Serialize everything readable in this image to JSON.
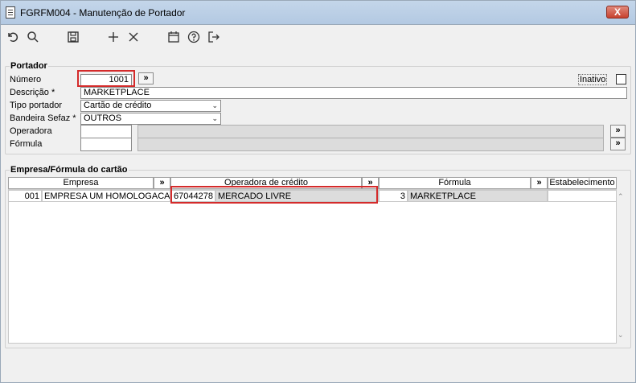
{
  "window": {
    "title": "FGRFM004 - Manutenção de Portador",
    "close_label": "X"
  },
  "toolbar": {
    "icons": [
      "undo-icon",
      "search-icon",
      "save-icon",
      "add-icon",
      "delete-icon",
      "calendar-icon",
      "help-icon",
      "exit-icon"
    ]
  },
  "portador": {
    "group_title": "Portador",
    "numero_label": "Número",
    "numero_value": "1001",
    "more_label": "»",
    "inativo_label": "Inativo",
    "inativo_checked": false,
    "descricao_label": "Descrição *",
    "descricao_value": "MARKETPLACE",
    "tipo_label": "Tipo portador",
    "tipo_value": "Cartão de crédito",
    "bandeira_label": "Bandeira Sefaz *",
    "bandeira_value": "OUTROS",
    "operadora_label": "Operadora",
    "operadora_value": "",
    "formula_label": "Fórmula",
    "formula_value": ""
  },
  "empresa": {
    "group_title": "Empresa/Fórmula do cartão",
    "columns": {
      "empresa": "Empresa",
      "operadora": "Operadora de crédito",
      "formula": "Fórmula",
      "estabelecimento": "Estabelecimento",
      "more": "»"
    },
    "rows": [
      {
        "empresa_code": "001",
        "empresa_name": "EMPRESA UM HOMOLOGACAO",
        "operadora_code": "67044278",
        "operadora_name": "MERCADO LIVRE",
        "formula_code": "3",
        "formula_name": "MARKETPLACE",
        "estabelecimento": ""
      }
    ]
  },
  "colors": {
    "highlight": "#d42b2b",
    "titlebar": "#b3c9e2"
  }
}
